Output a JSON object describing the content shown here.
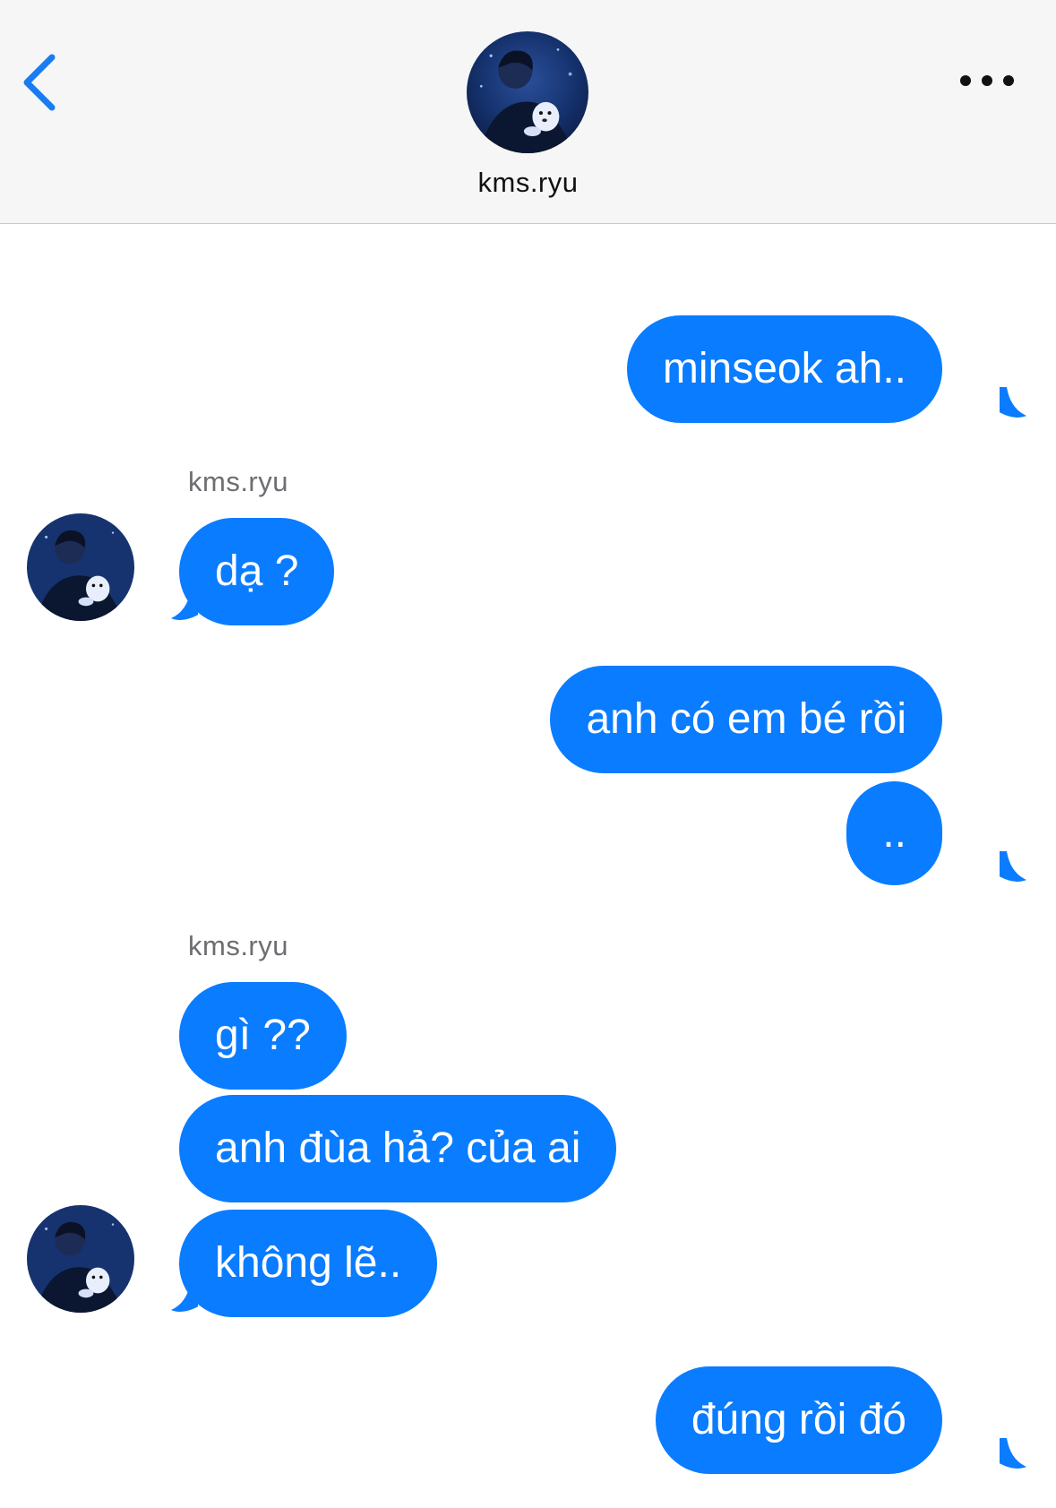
{
  "header": {
    "contact_name": "kms.ryu",
    "back_icon": "chevron-left-icon",
    "more_icon": "ellipsis-icon"
  },
  "messages": [
    {
      "from": "me",
      "text": "minseok ah.."
    },
    {
      "from": "them",
      "sender": "kms.ryu",
      "text": "dạ ?"
    },
    {
      "from": "me",
      "text": "anh có em bé rồi"
    },
    {
      "from": "me",
      "text": ".."
    },
    {
      "from": "them",
      "sender": "kms.ryu",
      "text": "gì ??"
    },
    {
      "from": "them",
      "text": "anh đùa hả? của ai"
    },
    {
      "from": "them",
      "text": "không lẽ.."
    },
    {
      "from": "me",
      "text": "đúng rồi đó"
    }
  ],
  "colors": {
    "bubble": "#0a7cff",
    "bubble_text": "#ffffff",
    "header_bg": "#f6f6f6",
    "accent": "#1a7cf2",
    "sender_label": "#6d6d72"
  }
}
